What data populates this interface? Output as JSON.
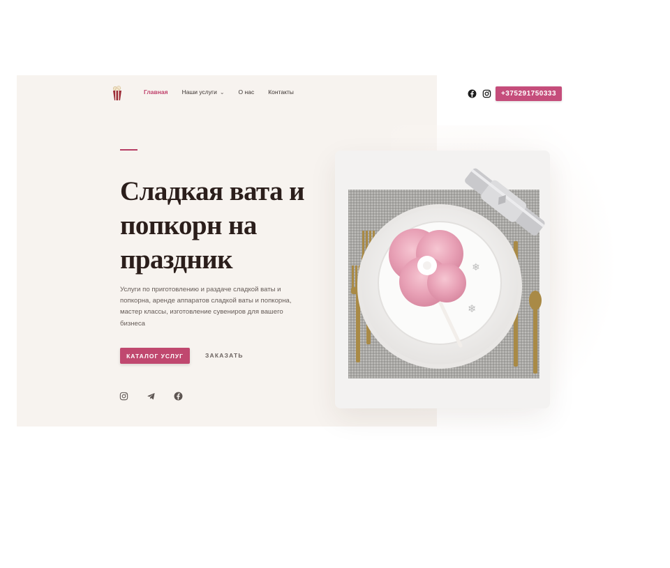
{
  "brand": {
    "logo_icon": "popcorn-icon"
  },
  "nav": {
    "items": [
      {
        "label": "Главная",
        "active": true
      },
      {
        "label": "Наши услуги",
        "has_dropdown": true
      },
      {
        "label": "О нас"
      },
      {
        "label": "Контакты"
      }
    ]
  },
  "header_social": [
    "facebook-icon",
    "instagram-icon"
  ],
  "phone": "+375291750333",
  "hero": {
    "title": "Сладкая вата и попкорн на праздник",
    "description": "Услуги по приготовлению и раздаче сладкой ваты и попкорна, аренде аппаратов сладкой ваты и попкорна, мастер классы, изготовление сувениров для вашего бизнеса",
    "primary_button": "КАТАЛОГ УСЛУГ",
    "secondary_button": "ЗАКАЗАТЬ"
  },
  "footer_social": [
    "instagram-icon",
    "telegram-icon",
    "facebook-icon"
  ],
  "colors": {
    "accent": "#c54d7b",
    "panel_bg": "#f7f3ef",
    "title": "#2b1e1b"
  }
}
